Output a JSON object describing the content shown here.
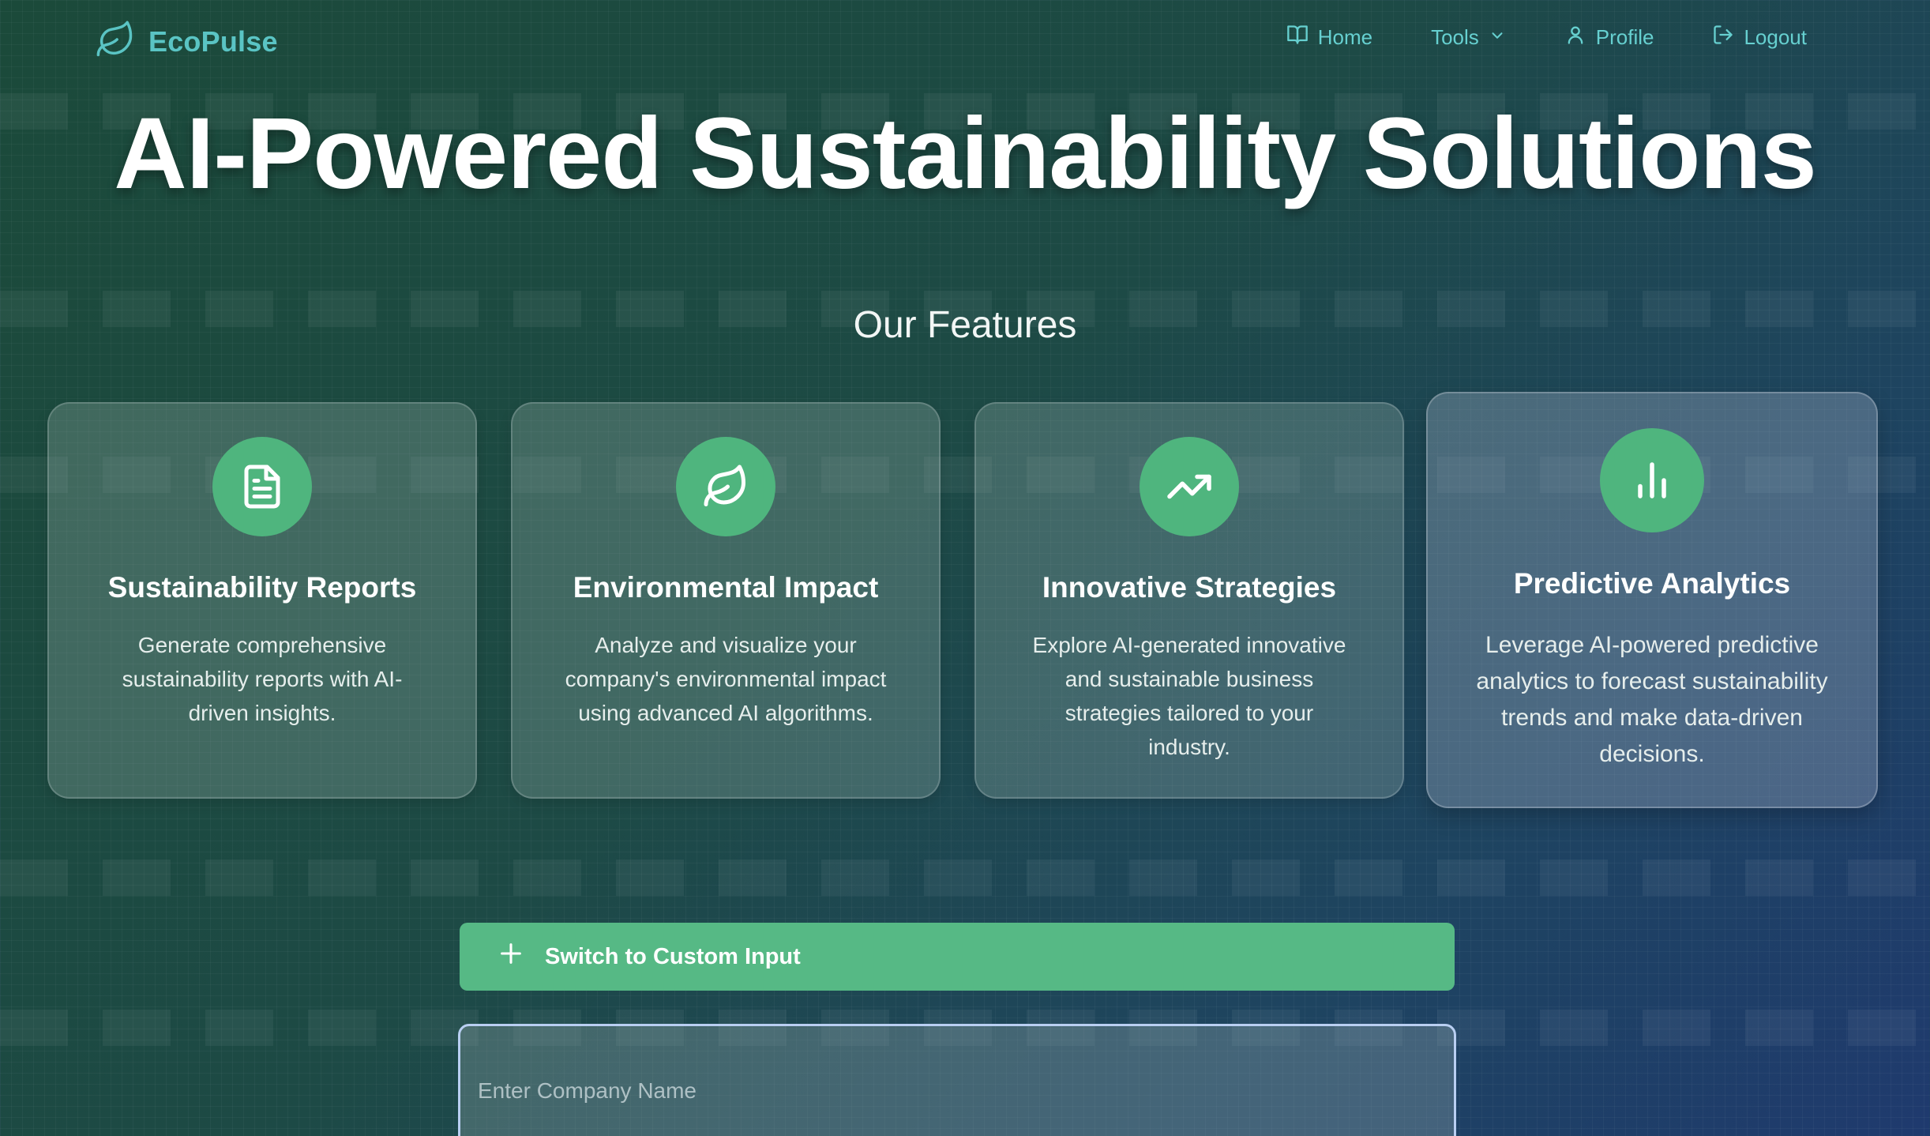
{
  "brand": {
    "name": "EcoPulse",
    "icon": "leaf-icon",
    "color": "#5ac4c4"
  },
  "nav": {
    "home": "Home",
    "tools": "Tools",
    "profile": "Profile",
    "logout": "Logout"
  },
  "hero": {
    "title": "AI-Powered Sustainability Solutions"
  },
  "features": {
    "heading": "Our Features",
    "items": [
      {
        "icon": "document-icon",
        "title": "Sustainability Reports",
        "text": "Generate comprehensive sustainability reports with AI-driven insights."
      },
      {
        "icon": "leaf-icon",
        "title": "Environmental Impact",
        "text": "Analyze and visualize your company's environmental impact using advanced AI algorithms."
      },
      {
        "icon": "trending-up-icon",
        "title": "Innovative Strategies",
        "text": "Explore AI-generated innovative and sustainable business strategies tailored to your industry."
      },
      {
        "icon": "bar-chart-icon",
        "title": "Predictive Analytics",
        "text": "Leverage AI-powered predictive analytics to forecast sustainability trends and make data-driven decisions."
      }
    ]
  },
  "actions": {
    "switch_label": "Switch to Custom Input",
    "company_placeholder": "Enter Company Name",
    "company_value": ""
  },
  "colors": {
    "accent_green": "#4fb57e",
    "nav_text": "#66d0d0",
    "input_border": "#b9cff2"
  }
}
